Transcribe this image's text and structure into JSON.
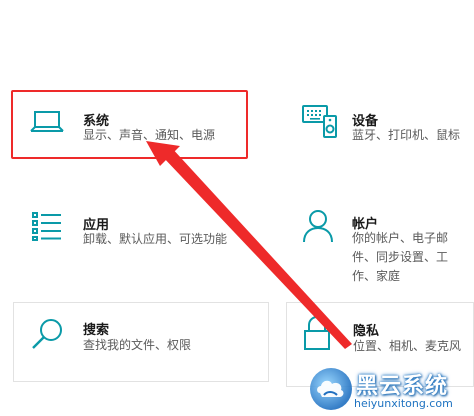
{
  "tiles": {
    "system": {
      "title": "系统",
      "desc": "显示、声音、通知、电源",
      "icon": "laptop-icon"
    },
    "devices": {
      "title": "设备",
      "desc": "蓝牙、打印机、鼠标",
      "icon": "keyboard-speaker-icon"
    },
    "apps": {
      "title": "应用",
      "desc": "卸载、默认应用、可选功能",
      "icon": "apps-list-icon"
    },
    "accounts": {
      "title": "帐户",
      "desc": "你的帐户、电子邮件、同步设置、工作、家庭",
      "icon": "person-icon"
    },
    "search": {
      "title": "搜索",
      "desc": "查找我的文件、权限",
      "icon": "magnifier-icon"
    },
    "privacy": {
      "title": "隐私",
      "desc": "位置、相机、麦克风",
      "icon": "lock-icon"
    }
  },
  "watermark": {
    "name": "黑云系统",
    "url": "heiyunxitong.com"
  },
  "colors": {
    "accent": "#0a9aa8",
    "highlight": "#ee2a2a"
  }
}
